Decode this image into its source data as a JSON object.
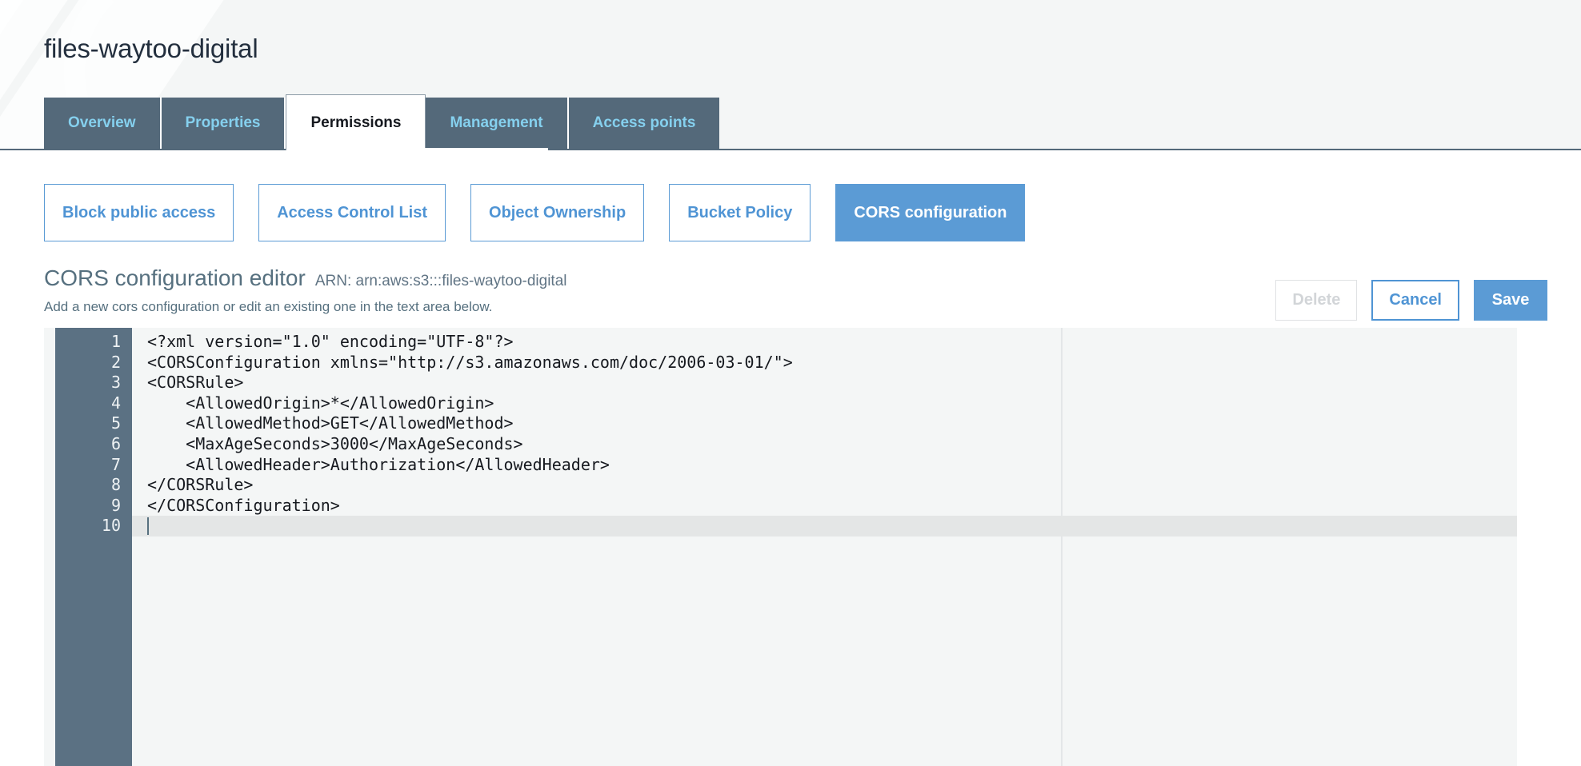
{
  "header": {
    "bucket_title": "files-waytoo-digital"
  },
  "tabs": [
    {
      "label": "Overview",
      "active": false
    },
    {
      "label": "Properties",
      "active": false
    },
    {
      "label": "Permissions",
      "active": true
    },
    {
      "label": "Management",
      "active": false
    },
    {
      "label": "Access points",
      "active": false
    }
  ],
  "subnav": [
    {
      "label": "Block public access",
      "selected": false
    },
    {
      "label": "Access Control List",
      "selected": false
    },
    {
      "label": "Object Ownership",
      "selected": false
    },
    {
      "label": "Bucket Policy",
      "selected": false
    },
    {
      "label": "CORS configuration",
      "selected": true
    }
  ],
  "editor_header": {
    "title": "CORS configuration editor",
    "arn": "ARN: arn:aws:s3:::files-waytoo-digital",
    "subtitle": "Add a new cors configuration or edit an existing one in the text area below."
  },
  "actions": {
    "delete_label": "Delete",
    "cancel_label": "Cancel",
    "save_label": "Save"
  },
  "code_editor": {
    "active_line": 10,
    "line_numbers": [
      "1",
      "2",
      "3",
      "4",
      "5",
      "6",
      "7",
      "8",
      "9",
      "10"
    ],
    "lines": [
      "<?xml version=\"1.0\" encoding=\"UTF-8\"?>",
      "<CORSConfiguration xmlns=\"http://s3.amazonaws.com/doc/2006-03-01/\">",
      "<CORSRule>",
      "    <AllowedOrigin>*</AllowedOrigin>",
      "    <AllowedMethod>GET</AllowedMethod>",
      "    <MaxAgeSeconds>3000</MaxAgeSeconds>",
      "    <AllowedHeader>Authorization</AllowedHeader>",
      "</CORSRule>",
      "</CORSConfiguration>",
      ""
    ]
  },
  "colors": {
    "tab_inactive_bg": "#54697a",
    "tab_inactive_text": "#85d0ee",
    "accent_blue": "#5b9bd5",
    "link_blue": "#4f94d4",
    "gutter_bg": "#5b7183",
    "editor_bg": "#f4f6f6",
    "header_band_bg": "#f4f6f6",
    "muted_text": "#56707f"
  }
}
